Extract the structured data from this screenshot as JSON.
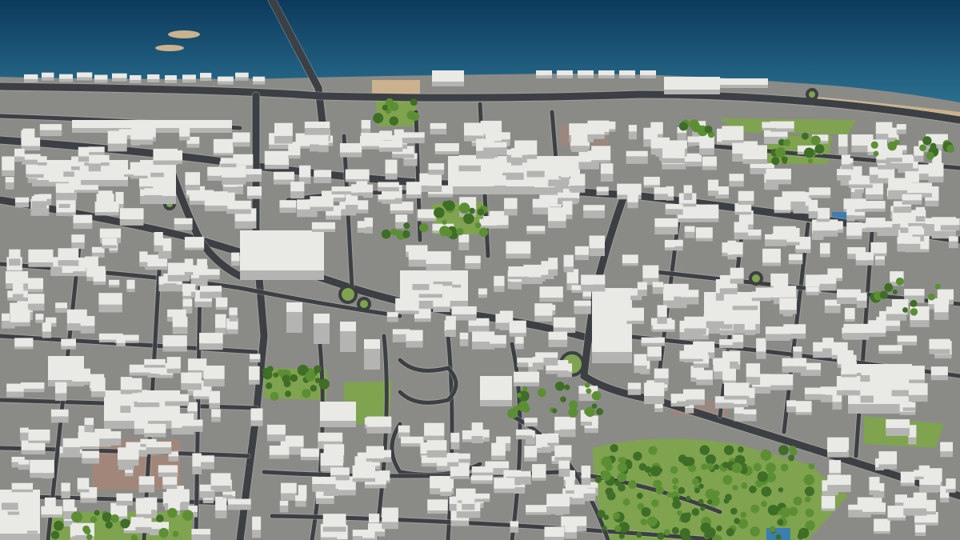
{
  "scene": {
    "colors": {
      "sea_top": "#0d3a5c",
      "sea_bottom": "#2a6f8f",
      "ground": "#8a8b87",
      "road": "#3c3f43",
      "road_edge": "#c9c9c4",
      "building_roof": "#e9e9e6",
      "building_side": "#b4b5b2",
      "grass": "#7fa34f",
      "tree": "#3f6e26",
      "tree_light": "#5c8f33",
      "sand": "#c9b28d",
      "clay_field": "#a3867a",
      "pool": "#3b7fb0"
    }
  }
}
